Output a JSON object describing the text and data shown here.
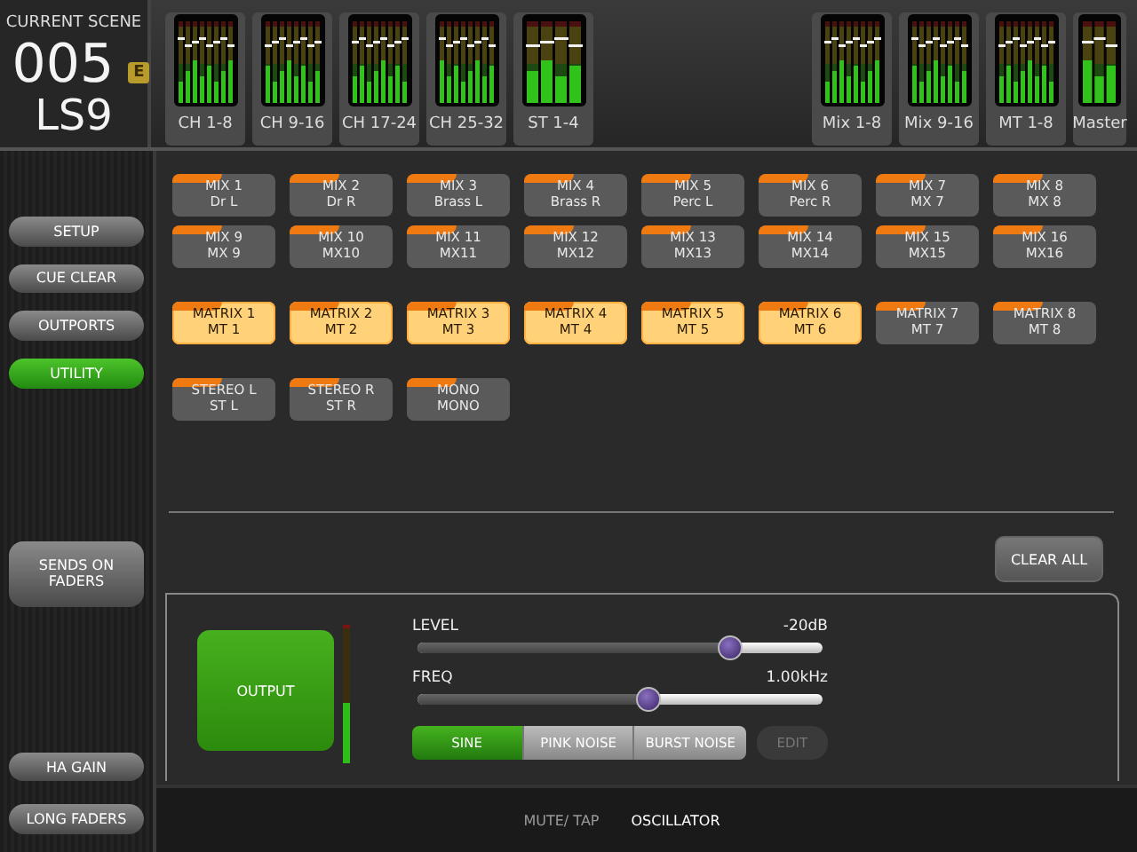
{
  "scene": {
    "label": "CURRENT SCENE",
    "number": "005",
    "badge": "E",
    "name": "LS9"
  },
  "meter_groups_left": [
    {
      "label": "CH 1-8",
      "kind": "group"
    },
    {
      "label": "CH 9-16",
      "kind": "group"
    },
    {
      "label": "CH 17-24",
      "kind": "group"
    },
    {
      "label": "CH 25-32",
      "kind": "group"
    },
    {
      "label": "ST 1-4",
      "kind": "stereo"
    }
  ],
  "meter_groups_right": [
    {
      "label": "Mix 1-8",
      "kind": "group"
    },
    {
      "label": "Mix 9-16",
      "kind": "group"
    },
    {
      "label": "MT 1-8",
      "kind": "group"
    },
    {
      "label": "Master",
      "kind": "master"
    }
  ],
  "sidebar": {
    "items": [
      {
        "label": "SETUP",
        "selected": false
      },
      {
        "label": "CUE CLEAR",
        "selected": false
      },
      {
        "label": "OUTPORTS",
        "selected": false
      },
      {
        "label": "UTILITY",
        "selected": true
      },
      {
        "label": "SENDS ON FADERS",
        "selected": false
      },
      {
        "label": "HA GAIN",
        "selected": false
      },
      {
        "label": "LONG FADERS",
        "selected": false
      }
    ]
  },
  "send_rows": [
    [
      {
        "title": "MIX 1",
        "subtitle": "Dr L",
        "selected": false
      },
      {
        "title": "MIX 2",
        "subtitle": "Dr R",
        "selected": false
      },
      {
        "title": "MIX 3",
        "subtitle": "Brass L",
        "selected": false
      },
      {
        "title": "MIX 4",
        "subtitle": "Brass R",
        "selected": false
      },
      {
        "title": "MIX 5",
        "subtitle": "Perc L",
        "selected": false
      },
      {
        "title": "MIX 6",
        "subtitle": "Perc R",
        "selected": false
      },
      {
        "title": "MIX 7",
        "subtitle": "MX 7",
        "selected": false
      },
      {
        "title": "MIX 8",
        "subtitle": "MX 8",
        "selected": false
      }
    ],
    [
      {
        "title": "MIX 9",
        "subtitle": "MX 9",
        "selected": false
      },
      {
        "title": "MIX 10",
        "subtitle": "MX10",
        "selected": false
      },
      {
        "title": "MIX 11",
        "subtitle": "MX11",
        "selected": false
      },
      {
        "title": "MIX 12",
        "subtitle": "MX12",
        "selected": false
      },
      {
        "title": "MIX 13",
        "subtitle": "MX13",
        "selected": false
      },
      {
        "title": "MIX 14",
        "subtitle": "MX14",
        "selected": false
      },
      {
        "title": "MIX 15",
        "subtitle": "MX15",
        "selected": false
      },
      {
        "title": "MIX 16",
        "subtitle": "MX16",
        "selected": false
      }
    ],
    [
      {
        "title": "MATRIX 1",
        "subtitle": "MT 1",
        "selected": true
      },
      {
        "title": "MATRIX 2",
        "subtitle": "MT 2",
        "selected": true
      },
      {
        "title": "MATRIX 3",
        "subtitle": "MT 3",
        "selected": true
      },
      {
        "title": "MATRIX 4",
        "subtitle": "MT 4",
        "selected": true
      },
      {
        "title": "MATRIX 5",
        "subtitle": "MT 5",
        "selected": true
      },
      {
        "title": "MATRIX 6",
        "subtitle": "MT 6",
        "selected": true
      },
      {
        "title": "MATRIX 7",
        "subtitle": "MT 7",
        "selected": false
      },
      {
        "title": "MATRIX 8",
        "subtitle": "MT 8",
        "selected": false
      }
    ],
    [
      {
        "title": "STEREO L",
        "subtitle": "ST L",
        "selected": false
      },
      {
        "title": "STEREO R",
        "subtitle": "ST R",
        "selected": false
      },
      {
        "title": "MONO",
        "subtitle": "MONO",
        "selected": false
      }
    ]
  ],
  "clear_all": "CLEAR ALL",
  "oscillator": {
    "output": {
      "label": "OUTPUT",
      "on": true
    },
    "output_meter": {
      "level": 0.45
    },
    "sliders": [
      {
        "label": "LEVEL",
        "reading": "-20dB",
        "level": 0.77
      },
      {
        "label": "FREQ",
        "reading": "1.00kHz",
        "level": 0.57
      }
    ],
    "waveforms": [
      {
        "label": "SINE",
        "selected": true
      },
      {
        "label": "PINK NOISE",
        "selected": false
      },
      {
        "label": "BURST NOISE",
        "selected": false
      }
    ],
    "edit": {
      "label": "EDIT",
      "disabled": true
    }
  },
  "tabs": [
    {
      "label": "MUTE/ TAP",
      "selected": false
    },
    {
      "label": "OSCILLATOR",
      "selected": true
    }
  ]
}
